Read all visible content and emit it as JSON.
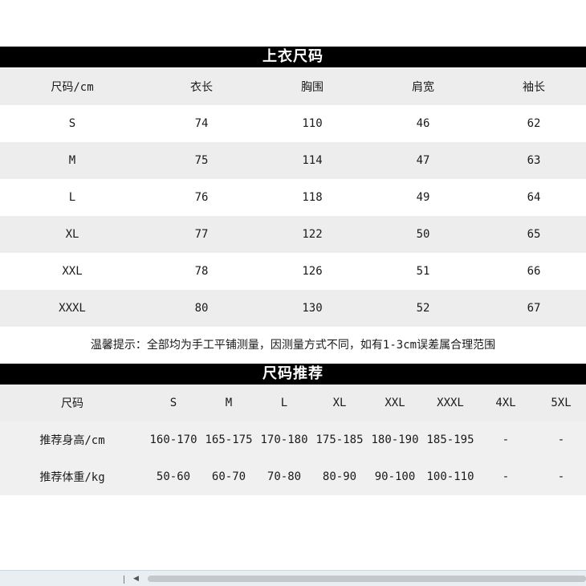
{
  "top_table": {
    "title": "上衣尺码",
    "headers": [
      "尺码/cm",
      "衣长",
      "胸围",
      "肩宽",
      "袖长"
    ],
    "rows": [
      [
        "S",
        "74",
        "110",
        "46",
        "62"
      ],
      [
        "M",
        "75",
        "114",
        "47",
        "63"
      ],
      [
        "L",
        "76",
        "118",
        "49",
        "64"
      ],
      [
        "XL",
        "77",
        "122",
        "50",
        "65"
      ],
      [
        "XXL",
        "78",
        "126",
        "51",
        "66"
      ],
      [
        "XXXL",
        "80",
        "130",
        "52",
        "67"
      ]
    ]
  },
  "note": "温馨提示：全部均为手工平铺测量，因测量方式不同，如有1-3cm误差属合理范围",
  "size_table": {
    "title": "尺码推荐",
    "headers": [
      "尺码",
      "S",
      "M",
      "L",
      "XL",
      "XXL",
      "XXXL",
      "4XL",
      "5XL"
    ],
    "rows": [
      [
        "推荐身高/cm",
        "160-170",
        "165-175",
        "170-180",
        "175-185",
        "180-190",
        "185-195",
        "-",
        "-"
      ],
      [
        "推荐体重/kg",
        "50-60",
        "60-70",
        "70-80",
        "80-90",
        "90-100",
        "100-110",
        "-",
        "-"
      ]
    ]
  },
  "colors": {
    "title_bg": "#000000",
    "title_fg": "#ffffff",
    "row_gray": "#ededed",
    "row_white": "#ffffff"
  }
}
